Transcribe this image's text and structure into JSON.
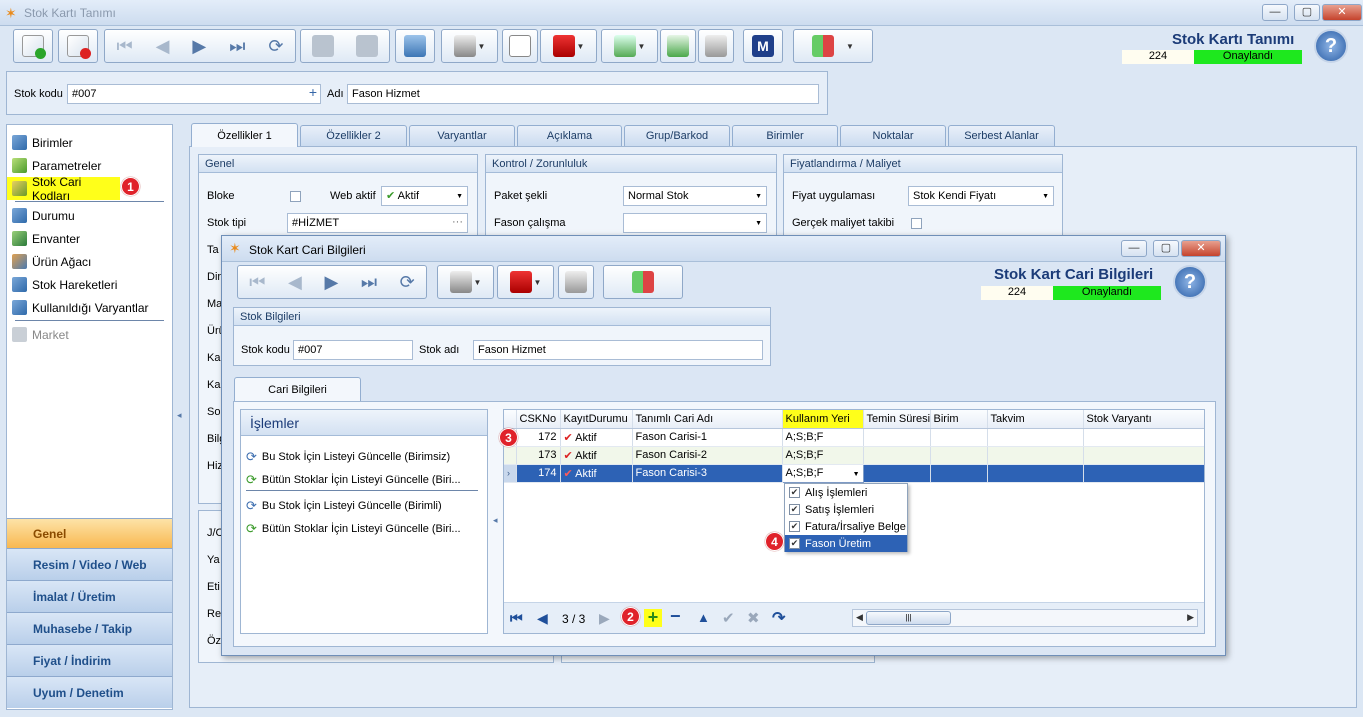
{
  "window": {
    "title": "Stok Kartı Tanımı"
  },
  "header": {
    "title": "Stok Kartı Tanımı",
    "record_no": "224",
    "status": "Onaylandı"
  },
  "stock": {
    "code_label": "Stok kodu",
    "code_value": "#007",
    "name_label": "Adı",
    "name_value": "Fason Hizmet"
  },
  "sidebar": {
    "items": [
      "Birimler",
      "Parametreler",
      "Stok Cari Kodları",
      "Durumu",
      "Envanter",
      "Ürün Ağacı",
      "Stok Hareketleri",
      "Kullanıldığı Varyantlar",
      "Market"
    ],
    "nav": [
      "Genel",
      "Resim / Video / Web",
      "İmalat / Üretim",
      "Muhasebe / Takip",
      "Fiyat / İndirim",
      "Uyum / Denetim"
    ]
  },
  "tabs": [
    "Özellikler 1",
    "Özellikler 2",
    "Varyantlar",
    "Açıklama",
    "Grup/Barkod",
    "Birimler",
    "Noktalar",
    "Serbest Alanlar"
  ],
  "genel": {
    "title": "Genel",
    "bloke": "Bloke",
    "web_aktif": "Web aktif",
    "web_aktif_value": "Aktif",
    "stok_tipi": "Stok tipi",
    "stok_tipi_value": "#HİZMET",
    "partials": [
      "Ta",
      "Dir",
      "Ma",
      "Ürü",
      "Ka",
      "Ka",
      "So",
      "Bilg",
      "Hiz"
    ],
    "lower_partials": [
      "J/C",
      "Ya",
      "Eti",
      "Re",
      "Öz"
    ]
  },
  "kontrol": {
    "title": "Kontrol / Zorunluluk",
    "paket": "Paket şekli",
    "paket_value": "Normal Stok",
    "fason": "Fason çalışma",
    "fason_value": ""
  },
  "fiyat": {
    "title": "Fiyatlandırma / Maliyet",
    "uyg": "Fiyat uygulaması",
    "uyg_value": "Stok Kendi Fiyatı",
    "maliyet": "Gerçek maliyet takibi"
  },
  "dialog": {
    "title": "Stok Kart Cari Bilgileri",
    "header_title": "Stok Kart Cari Bilgileri",
    "record_no": "224",
    "status": "Onaylandı",
    "stok_bilgileri": "Stok Bilgileri",
    "code_label": "Stok kodu",
    "code_value": "#007",
    "name_label": "Stok adı",
    "name_value": "Fason Hizmet",
    "tab": "Cari Bilgileri",
    "islemler_title": "İşlemler",
    "actions": [
      "Bu Stok İçin Listeyi Güncelle (Birimsiz)",
      "Bütün Stoklar İçin Listeyi Güncelle (Biri...",
      "Bu Stok İçin Listeyi Güncelle (Birimli)",
      "Bütün Stoklar İçin Listeyi Güncelle (Biri..."
    ],
    "grid": {
      "columns": [
        "CSKNo",
        "KayıtDurumu",
        "Tanımlı Cari Adı",
        "Kullanım Yeri",
        "Temin Süresi",
        "Birim",
        "Takvim",
        "Stok Varyantı"
      ],
      "rows": [
        {
          "no": "172",
          "durum": "Aktif",
          "cari": "Fason Carisi-1",
          "yer": "A;S;B;F"
        },
        {
          "no": "173",
          "durum": "Aktif",
          "cari": "Fason Carisi-2",
          "yer": "A;S;B;F"
        },
        {
          "no": "174",
          "durum": "Aktif",
          "cari": "Fason Carisi-3",
          "yer": "A;S;B;F"
        }
      ]
    },
    "dropdown": [
      "Alış İşlemleri",
      "Satış İşlemleri",
      "Fatura/İrsaliye Belge",
      "Fason Üretim"
    ],
    "pager": "3 / 3"
  },
  "badges": [
    "1",
    "2",
    "3",
    "4"
  ],
  "colors": {
    "status_green": "#1ee81e",
    "highlight_yellow": "#ffff1a",
    "badge_red": "#e0222a"
  }
}
